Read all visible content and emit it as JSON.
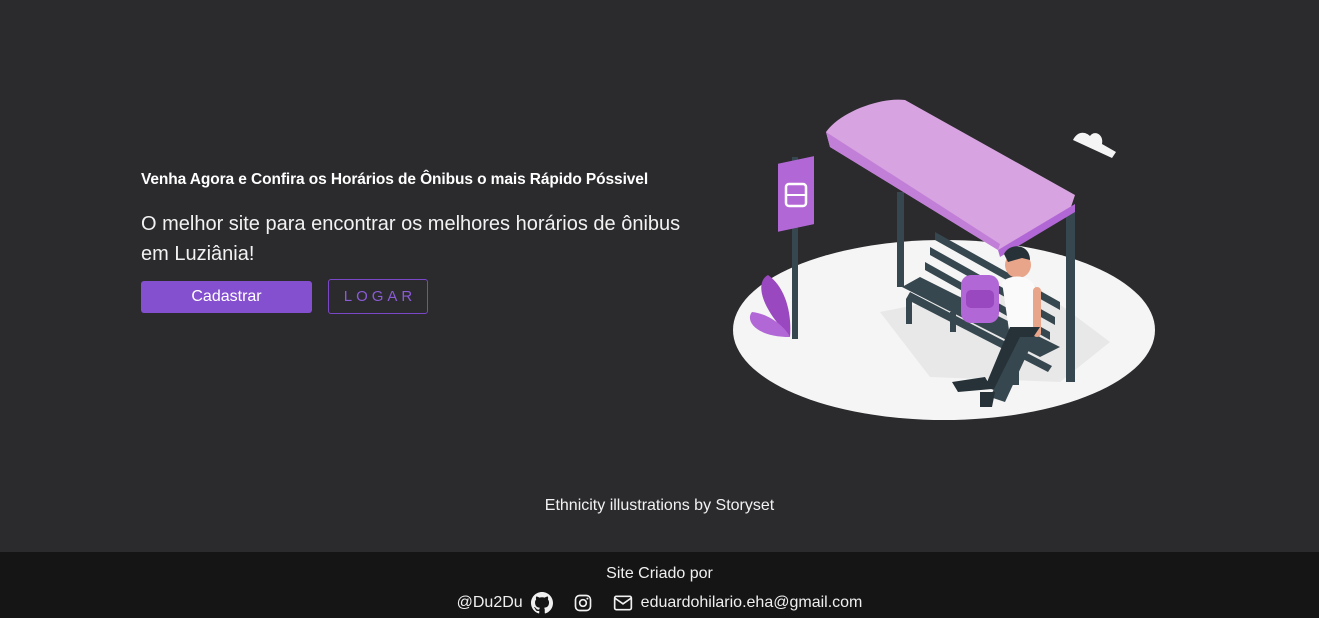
{
  "hero": {
    "headline": "Venha Agora e Confira os Horários de Ônibus o mais Rápido Póssivel",
    "subtitle": "O melhor site para encontrar os melhores horários de ônibus em Luziânia!",
    "register_label": "Cadastrar",
    "login_label": "LOGAR"
  },
  "illustration": {
    "icon": "bus-stop-illustration"
  },
  "credit": "Ethnicity illustrations by Storyset",
  "footer": {
    "title": "Site Criado por",
    "handle": "@Du2Du",
    "email": "eduardohilario.eha@gmail.com",
    "icons": [
      "github-icon",
      "instagram-icon",
      "mail-icon"
    ]
  },
  "colors": {
    "background": "#2b2a2d",
    "footer": "#151515",
    "accent": "#8550cf",
    "roof": "#d7a3e0"
  }
}
